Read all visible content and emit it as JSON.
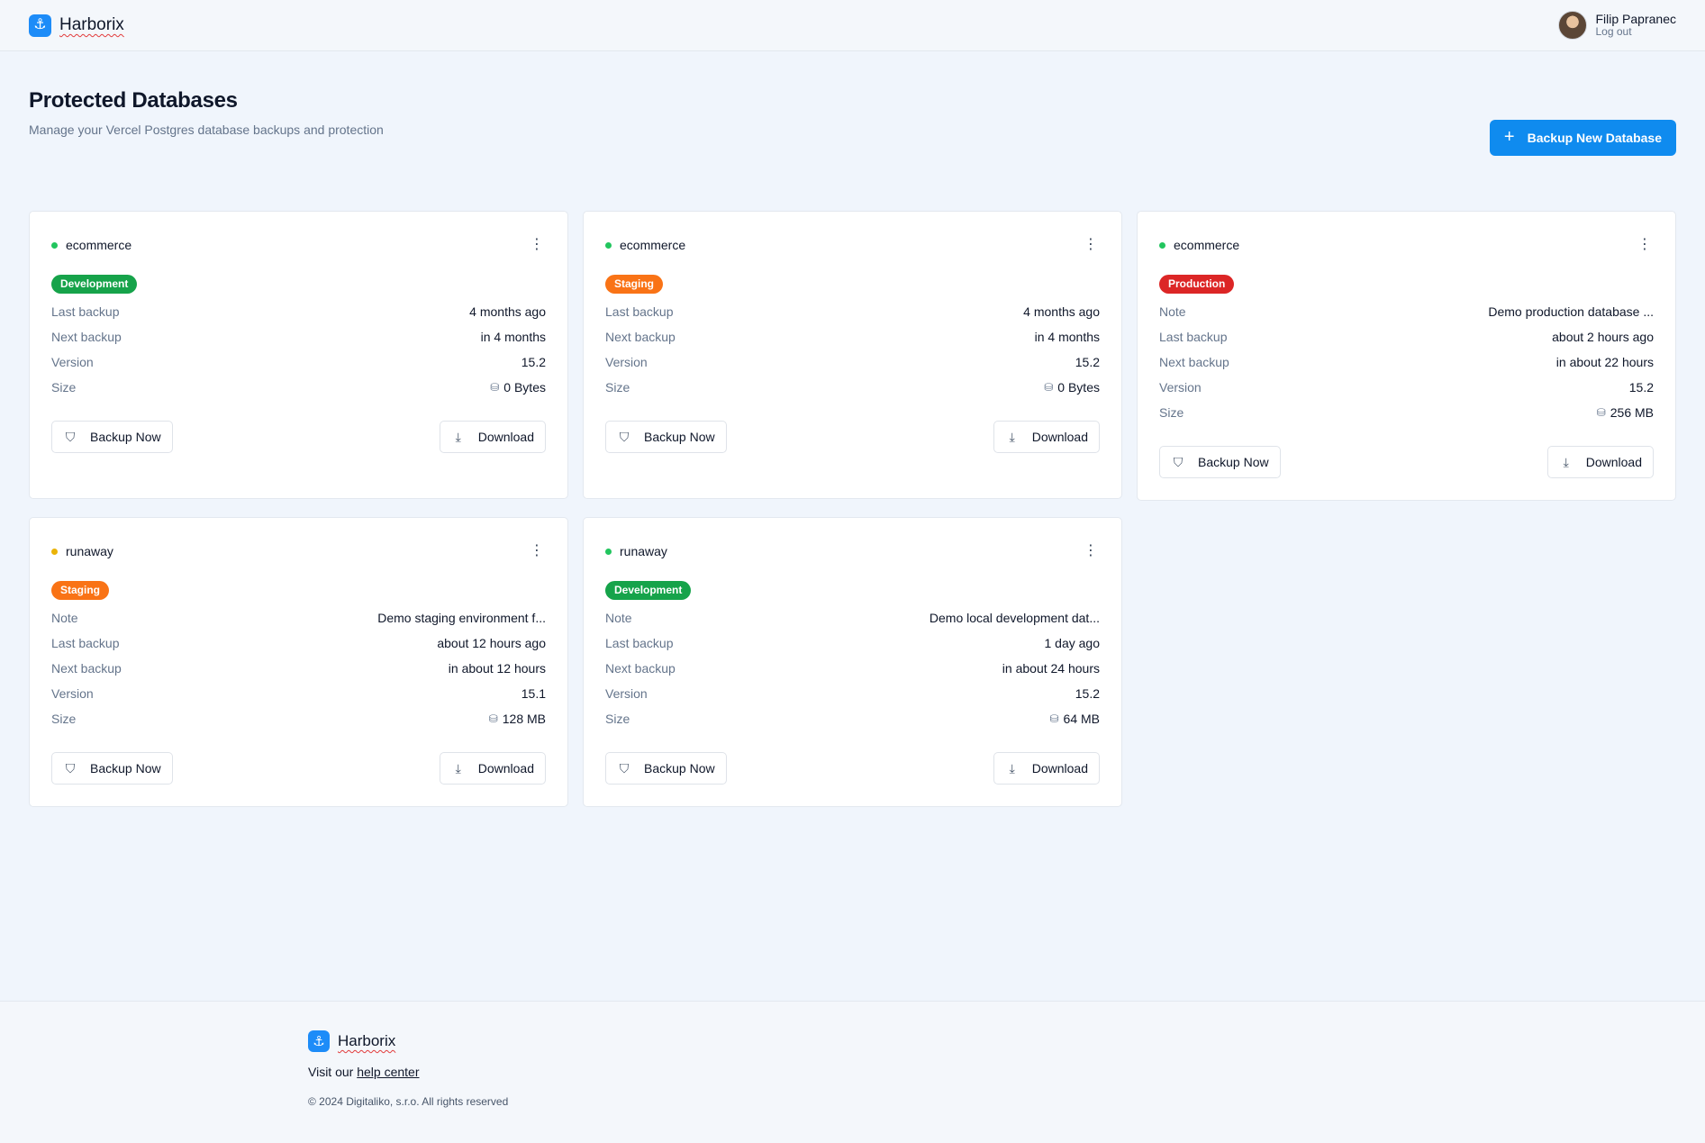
{
  "brand": {
    "name": "Harborix",
    "logo_icon": "anchor-icon"
  },
  "user": {
    "name": "Filip Papranec",
    "logout": "Log out"
  },
  "header": {
    "title": "Protected Databases",
    "subtitle": "Manage your Vercel Postgres database backups and protection",
    "new_button": "Backup New Database"
  },
  "labels": {
    "note": "Note",
    "last_backup": "Last backup",
    "next_backup": "Next backup",
    "version": "Version",
    "size": "Size",
    "backup_now": "Backup Now",
    "download": "Download"
  },
  "databases": [
    {
      "name": "ecommerce",
      "status_color": "#22c55e",
      "env": "Development",
      "note": null,
      "last_backup": "4 months ago",
      "next_backup": "in 4 months",
      "version": "15.2",
      "size": "0 Bytes"
    },
    {
      "name": "ecommerce",
      "status_color": "#22c55e",
      "env": "Staging",
      "note": null,
      "last_backup": "4 months ago",
      "next_backup": "in 4 months",
      "version": "15.2",
      "size": "0 Bytes"
    },
    {
      "name": "ecommerce",
      "status_color": "#22c55e",
      "env": "Production",
      "note": "Demo production database ...",
      "last_backup": "about 2 hours ago",
      "next_backup": "in about 22 hours",
      "version": "15.2",
      "size": "256 MB"
    },
    {
      "name": "runaway",
      "status_color": "#eab308",
      "env": "Staging",
      "note": "Demo staging environment f...",
      "last_backup": "about 12 hours ago",
      "next_backup": "in about 12 hours",
      "version": "15.1",
      "size": "128 MB"
    },
    {
      "name": "runaway",
      "status_color": "#22c55e",
      "env": "Development",
      "note": "Demo local development dat...",
      "last_backup": "1 day ago",
      "next_backup": "in about 24 hours",
      "version": "15.2",
      "size": "64 MB"
    }
  ],
  "footer": {
    "brand": "Harborix",
    "help_prefix": "Visit our",
    "help_link": "help center",
    "copyright": "© 2024 Digitaliko, s.r.o. All rights reserved"
  },
  "colors": {
    "accent": "#0f8bef",
    "development": "#16a34a",
    "staging": "#f97316",
    "production": "#dc2626"
  }
}
